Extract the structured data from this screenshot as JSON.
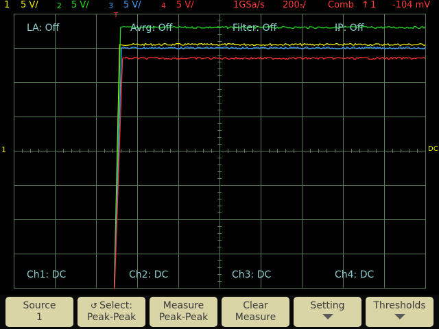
{
  "status": {
    "ch1_num": "1",
    "ch1_scale": "5 V/",
    "ch2_num": "2",
    "ch2_scale": "5 V/",
    "ch3_num": "3",
    "ch3_scale": "5 V/",
    "ch4_num": "4",
    "ch4_scale": "5 V/",
    "sample_rate": "1GSa/s",
    "timebase": "200",
    "timebase_unit": "s",
    "trigger": "Comb",
    "trigger_slope": "↑",
    "trigger_source": "1",
    "trigger_level": "-104 mV"
  },
  "overlay": {
    "la": "LA: Off",
    "avrg": "Avrg: Off",
    "filter": "Filter: Off",
    "ip": "IP: Off",
    "ch1_coupling": "Ch1: DC",
    "ch2_coupling": "Ch2: DC",
    "ch3_coupling": "Ch3: DC",
    "ch4_coupling": "Ch4: DC"
  },
  "markers": {
    "trigger_pos": "T",
    "left_ground": "1",
    "right_coupling": "DC"
  },
  "colors": {
    "ch1": "#f0f000",
    "ch2": "#22dd22",
    "ch3": "#3aa0ff",
    "ch4": "#ff3030",
    "grid": "#5a7a5a",
    "background": "#000000",
    "softkey": "#d9d5a6"
  },
  "softkeys": [
    {
      "line1": "Source",
      "line2": "1",
      "icon": "chevron-down-icon"
    },
    {
      "line1": "Select:",
      "line2": "Peak-Peak",
      "icon": "knob-icon"
    },
    {
      "line1": "Measure",
      "line2": "Peak-Peak"
    },
    {
      "line1": "Clear",
      "line2": "Measure"
    },
    {
      "line1": "Setting",
      "icon": "arrow-down-icon"
    },
    {
      "line1": "Thresholds",
      "icon": "arrow-down-icon"
    }
  ],
  "chart_data": {
    "type": "line",
    "description_values": "step response of 4 channels, low level ~ -4.5 div, high level ~ +3.5 div",
    "series": [
      {
        "name": "1",
        "level_low": -4.5,
        "level_high": 3.1
      },
      {
        "name": "2",
        "level_low": -4.5,
        "level_high": 3.6
      },
      {
        "name": "3",
        "level_low": -4.5,
        "level_high": 3.0
      },
      {
        "name": "4",
        "level_low": -4.6,
        "level_high": 2.7
      }
    ]
  }
}
